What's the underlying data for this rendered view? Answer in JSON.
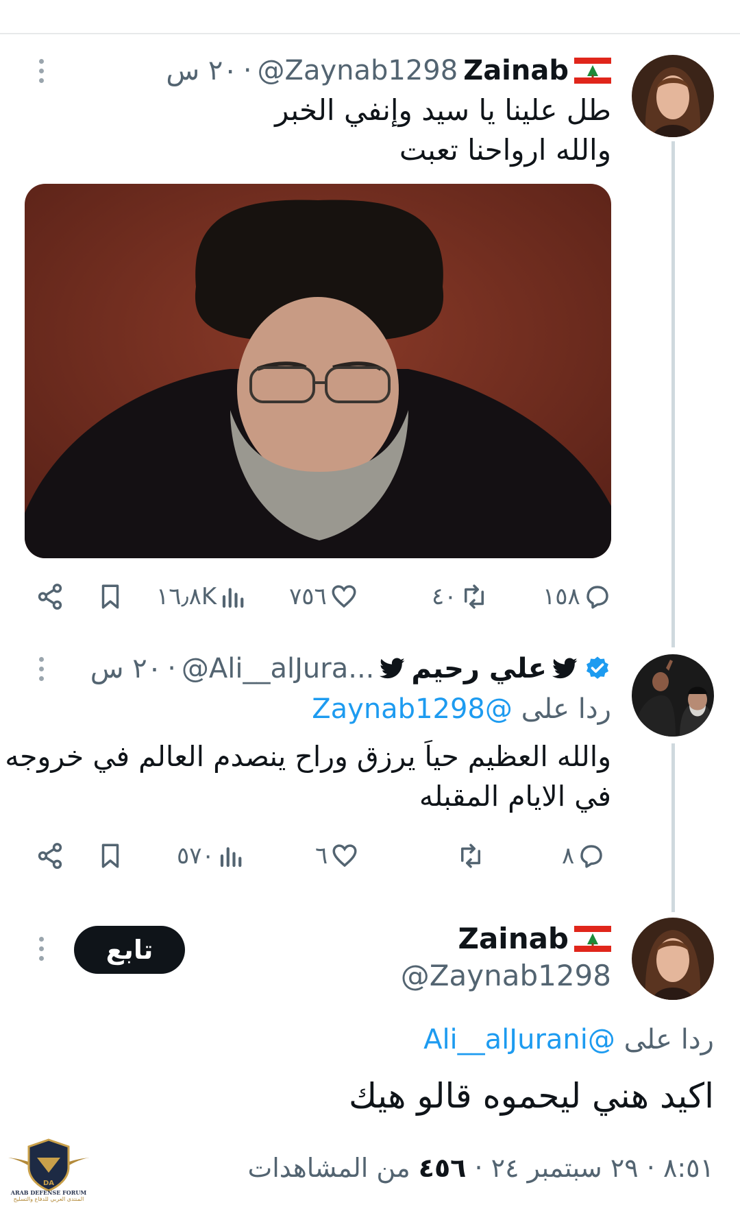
{
  "tweet1": {
    "name": "Zainab",
    "handle": "@Zaynab1298",
    "time": "٢٠ س",
    "lines": [
      "طل علينا يا سيد وإنفي الخبر",
      "والله ارواحنا تعبت"
    ],
    "stats": {
      "replies": "١٥٨",
      "retweets": "٤٠",
      "likes": "٧٥٦",
      "views": "١٦٫٨K"
    }
  },
  "tweet2": {
    "name": "علي رحيم",
    "handle": "@Ali__alJura...",
    "time": "٢٠ س",
    "reply_prefix": "ردا على",
    "reply_to": "@Zaynab1298",
    "lines": [
      "والله العظيم حياَ يرزق وراح ينصدم العالم في خروجه",
      "في الايام المقبله"
    ],
    "stats": {
      "replies": "٨",
      "retweets": "",
      "likes": "٦",
      "views": "٥٧٠"
    }
  },
  "main": {
    "name": "Zainab",
    "handle": "@Zaynab1298",
    "follow_label": "تابع",
    "reply_prefix": "ردا على",
    "reply_to": "@Ali__alJurani",
    "text": "اكيد هني ليحموه قالو هيك",
    "time": "٨:٥١",
    "date": "٢٩ سبتمبر ٢٤",
    "views_count": "٤٥٦",
    "views_label": "من المشاهدات"
  },
  "logo": {
    "brand": "ARAB DEFENSE FORUM",
    "arabic": "المنتدى العربي للدفاع والتسليح",
    "mark": "DA"
  },
  "colors": {
    "accent": "#1d9bf0",
    "text": "#0f1419",
    "muted": "#536471",
    "verified": "#1d9bf0"
  },
  "icons": [
    "more-icon",
    "lebanon-flag-icon",
    "reply-icon",
    "retweet-icon",
    "like-icon",
    "views-icon",
    "bookmark-icon",
    "share-icon",
    "verified-badge-icon",
    "bird-icon"
  ]
}
